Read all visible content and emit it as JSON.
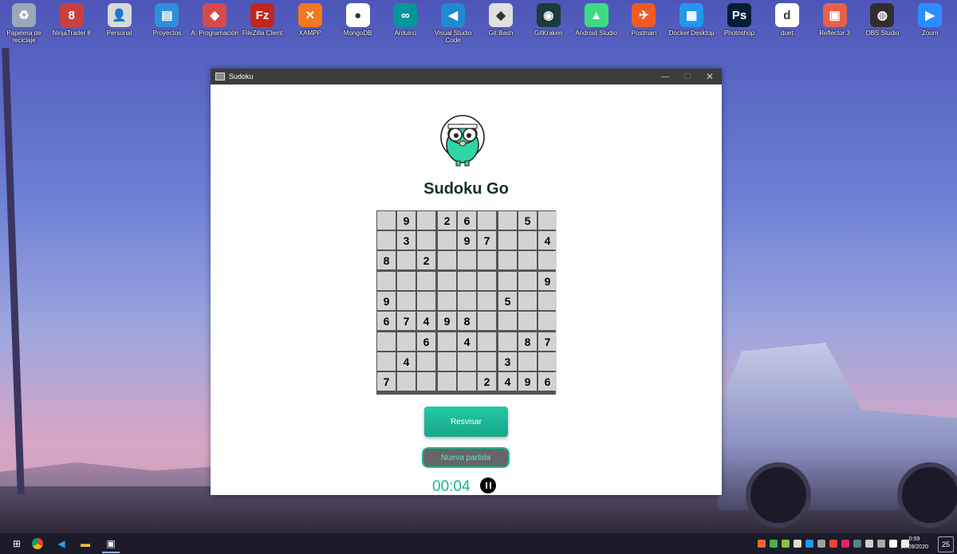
{
  "desktop": {
    "icons": [
      {
        "label": "Papelera de reciclaje",
        "color": "#9aa8b8",
        "glyph": "♻"
      },
      {
        "label": "NinjaTrader 8",
        "color": "#c94040",
        "glyph": "8"
      },
      {
        "label": "Personal",
        "color": "#d9d9d9",
        "glyph": "👤"
      },
      {
        "label": "Proyectos",
        "color": "#2f8fd8",
        "glyph": "▤"
      },
      {
        "label": "A. Programación",
        "color": "#d84a4a",
        "glyph": "◆"
      },
      {
        "label": "FileZilla Client",
        "color": "#c0261d",
        "glyph": "Fz"
      },
      {
        "label": "XAMPP",
        "color": "#f3781e",
        "glyph": "✕"
      },
      {
        "label": "MongoDB",
        "color": "#ffffff",
        "glyph": "●"
      },
      {
        "label": "Arduino",
        "color": "#00979c",
        "glyph": "∞"
      },
      {
        "label": "Visual Studio Code",
        "color": "#1f8ad2",
        "glyph": "◀"
      },
      {
        "label": "Git Bash",
        "color": "#e0e0e0",
        "glyph": "◆"
      },
      {
        "label": "GitKraken",
        "color": "#1d3b3b",
        "glyph": "◉"
      },
      {
        "label": "Android Studio",
        "color": "#3ddc84",
        "glyph": "▲"
      },
      {
        "label": "Postman",
        "color": "#ef5b25",
        "glyph": "✈"
      },
      {
        "label": "Docker Desktop",
        "color": "#2496ed",
        "glyph": "▦"
      },
      {
        "label": "Photoshop",
        "color": "#001e36",
        "glyph": "Ps"
      },
      {
        "label": "duet",
        "color": "#ffffff",
        "glyph": "d"
      },
      {
        "label": "Reflector 3",
        "color": "#e8604c",
        "glyph": "▣"
      },
      {
        "label": "OBS Studio",
        "color": "#302e31",
        "glyph": "◍"
      },
      {
        "label": "Zoom",
        "color": "#2d8cff",
        "glyph": "▶"
      }
    ]
  },
  "window": {
    "title": "Sudoku",
    "app_title": "Sudoku Go",
    "board": [
      [
        "",
        "9",
        "",
        "2",
        "6",
        "",
        "",
        "5",
        ""
      ],
      [
        "",
        "3",
        "",
        "",
        "9",
        "7",
        "",
        "",
        "4"
      ],
      [
        "8",
        "",
        "2",
        "",
        "",
        "",
        "",
        "",
        ""
      ],
      [
        "",
        "",
        "",
        "",
        "",
        "",
        "",
        "",
        "9"
      ],
      [
        "9",
        "",
        "",
        "",
        "",
        "",
        "5",
        "",
        ""
      ],
      [
        "6",
        "7",
        "4",
        "9",
        "8",
        "",
        "",
        "",
        ""
      ],
      [
        "",
        "",
        "6",
        "",
        "4",
        "",
        "",
        "8",
        "7"
      ],
      [
        "",
        "4",
        "",
        "",
        "",
        "",
        "3",
        "",
        ""
      ],
      [
        "7",
        "",
        "",
        "",
        "",
        "2",
        "4",
        "9",
        "6"
      ]
    ],
    "check_button": "Resvisar",
    "new_game_button": "Nueva partida",
    "timer": "00:04",
    "accent_color": "#19b597"
  },
  "taskbar": {
    "time": "0:59",
    "date": "17/09/2020",
    "notification_count": "25"
  }
}
